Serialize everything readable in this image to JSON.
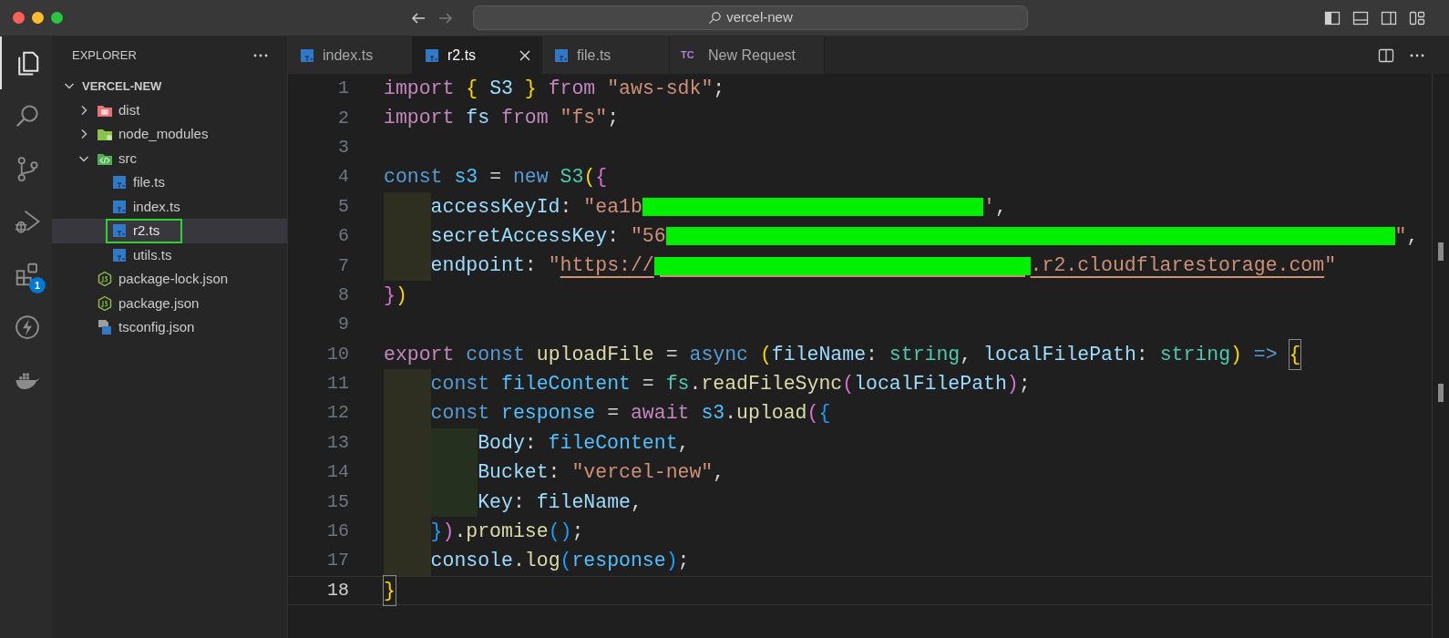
{
  "title_bar": {
    "search_field": {
      "value": "vercel-new"
    }
  },
  "activity_bar": [
    {
      "kind": "files",
      "selected": true
    },
    {
      "kind": "search",
      "selected": false
    },
    {
      "kind": "source-control",
      "selected": false
    },
    {
      "kind": "run-debug",
      "selected": false
    },
    {
      "kind": "extensions",
      "selected": false,
      "badge": "1"
    },
    {
      "kind": "lightning",
      "selected": false
    },
    {
      "kind": "docker",
      "selected": false
    }
  ],
  "explorer": {
    "title": "EXPLORER",
    "tree": [
      {
        "label": "VERCEL-NEW",
        "kind": "root",
        "expanded": true,
        "selected": false,
        "outlined": false,
        "children": [
          {
            "label": "dist",
            "kind": "folder-red",
            "expanded": false,
            "selected": false,
            "outlined": false
          },
          {
            "label": "node_modules",
            "kind": "folder-green",
            "expanded": false,
            "selected": false,
            "outlined": false
          },
          {
            "label": "src",
            "kind": "folder-code",
            "expanded": true,
            "selected": false,
            "outlined": false,
            "children": [
              {
                "label": "file.ts",
                "kind": "ts",
                "selected": false,
                "outlined": false
              },
              {
                "label": "index.ts",
                "kind": "ts",
                "selected": false,
                "outlined": false
              },
              {
                "label": "r2.ts",
                "kind": "ts",
                "selected": true,
                "outlined": true
              },
              {
                "label": "utils.ts",
                "kind": "ts",
                "selected": false,
                "outlined": false
              }
            ]
          },
          {
            "label": "package-lock.json",
            "kind": "json",
            "selected": false,
            "outlined": false
          },
          {
            "label": "package.json",
            "kind": "json",
            "selected": false,
            "outlined": false
          },
          {
            "label": "tsconfig.json",
            "kind": "tsconfig",
            "selected": false,
            "outlined": false
          }
        ]
      }
    ]
  },
  "tabs": [
    {
      "label": "index.ts",
      "kind": "ts",
      "selected": false
    },
    {
      "label": "r2.ts",
      "kind": "ts",
      "selected": true
    },
    {
      "label": "file.ts",
      "kind": "ts",
      "selected": false
    },
    {
      "label": "New Request",
      "kind": "badge",
      "badge": "TC",
      "selected": false
    }
  ],
  "editor": {
    "lines": [
      {
        "number": "1",
        "current": false,
        "tokens": [
          {
            "text": "import ",
            "kind": "keyword"
          },
          {
            "text": "{",
            "kind": "bracket1"
          },
          {
            "text": " S3 ",
            "kind": "variable"
          },
          {
            "text": "}",
            "kind": "bracket1"
          },
          {
            "text": " from ",
            "kind": "keyword"
          },
          {
            "text": "\"aws-sdk\"",
            "kind": "string"
          },
          {
            "text": ";",
            "kind": "punct"
          }
        ]
      },
      {
        "number": "2",
        "current": false,
        "tokens": [
          {
            "text": "import ",
            "kind": "keyword"
          },
          {
            "text": "fs",
            "kind": "variable"
          },
          {
            "text": " from ",
            "kind": "keyword"
          },
          {
            "text": "\"fs\"",
            "kind": "string"
          },
          {
            "text": ";",
            "kind": "punct"
          }
        ]
      },
      {
        "number": "3",
        "current": false
      },
      {
        "number": "4",
        "current": false,
        "tokens": [
          {
            "text": "const ",
            "kind": "storage"
          },
          {
            "text": "s3",
            "kind": "constant"
          },
          {
            "text": " = ",
            "kind": "punct"
          },
          {
            "text": "new ",
            "kind": "storage"
          },
          {
            "text": "S3",
            "kind": "type"
          },
          {
            "text": "(",
            "kind": "bracket1"
          },
          {
            "text": "{",
            "kind": "bracket2"
          }
        ]
      },
      {
        "number": "5",
        "current": false,
        "tokens": [
          {
            "kind": "indent"
          },
          {
            "text": "accessKeyId",
            "kind": "variable"
          },
          {
            "text": ": ",
            "kind": "punct"
          },
          {
            "text": "\"ea1b",
            "kind": "string"
          },
          {
            "kind": "redaction"
          },
          {
            "text": "'",
            "kind": "string"
          },
          {
            "text": ",",
            "kind": "punct"
          }
        ]
      },
      {
        "number": "6",
        "current": false,
        "tokens": [
          {
            "kind": "indent"
          },
          {
            "text": "secretAccessKey",
            "kind": "variable"
          },
          {
            "text": ": ",
            "kind": "punct"
          },
          {
            "text": "\"56",
            "kind": "string"
          },
          {
            "kind": "redaction"
          },
          {
            "text": "\"",
            "kind": "string"
          },
          {
            "text": ",",
            "kind": "punct"
          }
        ]
      },
      {
        "number": "7",
        "current": false,
        "tokens": [
          {
            "kind": "indent"
          },
          {
            "text": "endpoint",
            "kind": "variable"
          },
          {
            "text": ": ",
            "kind": "punct"
          },
          {
            "text": "\"",
            "kind": "string"
          },
          {
            "text": "https://",
            "kind": "link"
          },
          {
            "kind": "redaction-link"
          },
          {
            "text": ".r2.cloudflarestorage.com",
            "kind": "link"
          },
          {
            "text": "\"",
            "kind": "string"
          }
        ]
      },
      {
        "number": "8",
        "current": false,
        "tokens": [
          {
            "text": "}",
            "kind": "bracket2"
          },
          {
            "text": ")",
            "kind": "bracket1"
          }
        ]
      },
      {
        "number": "9",
        "current": false
      },
      {
        "number": "10",
        "current": false,
        "tokens": [
          {
            "text": "export ",
            "kind": "keyword"
          },
          {
            "text": "const ",
            "kind": "storage"
          },
          {
            "text": "uploadFile",
            "kind": "function"
          },
          {
            "text": " = ",
            "kind": "punct"
          },
          {
            "text": "async ",
            "kind": "storage"
          },
          {
            "text": "(",
            "kind": "bracket1"
          },
          {
            "text": "fileName",
            "kind": "variable"
          },
          {
            "text": ": ",
            "kind": "punct"
          },
          {
            "text": "string",
            "kind": "type"
          },
          {
            "text": ", ",
            "kind": "punct"
          },
          {
            "text": "localFilePath",
            "kind": "variable"
          },
          {
            "text": ": ",
            "kind": "punct"
          },
          {
            "text": "string",
            "kind": "type"
          },
          {
            "text": ")",
            "kind": "bracket1"
          },
          {
            "text": " => ",
            "kind": "storage"
          },
          {
            "text": "{",
            "kind": "bracket1-match"
          }
        ]
      },
      {
        "number": "11",
        "current": false,
        "tokens": [
          {
            "kind": "indent"
          },
          {
            "text": "const ",
            "kind": "storage"
          },
          {
            "text": "fileContent",
            "kind": "constant"
          },
          {
            "text": " = ",
            "kind": "punct"
          },
          {
            "text": "fs",
            "kind": "type"
          },
          {
            "text": ".",
            "kind": "punct"
          },
          {
            "text": "readFileSync",
            "kind": "function"
          },
          {
            "text": "(",
            "kind": "bracket2"
          },
          {
            "text": "localFilePath",
            "kind": "variable"
          },
          {
            "text": ")",
            "kind": "bracket2"
          },
          {
            "text": ";",
            "kind": "punct"
          }
        ]
      },
      {
        "number": "12",
        "current": false,
        "tokens": [
          {
            "kind": "indent"
          },
          {
            "text": "const ",
            "kind": "storage"
          },
          {
            "text": "response",
            "kind": "constant"
          },
          {
            "text": " = ",
            "kind": "punct"
          },
          {
            "text": "await ",
            "kind": "keyword"
          },
          {
            "text": "s3",
            "kind": "constant"
          },
          {
            "text": ".",
            "kind": "punct"
          },
          {
            "text": "upload",
            "kind": "function"
          },
          {
            "text": "(",
            "kind": "bracket2"
          },
          {
            "text": "{",
            "kind": "bracket3"
          }
        ]
      },
      {
        "number": "13",
        "current": false,
        "tokens": [
          {
            "kind": "indent"
          },
          {
            "kind": "indent"
          },
          {
            "text": "Body",
            "kind": "variable"
          },
          {
            "text": ": ",
            "kind": "punct"
          },
          {
            "text": "fileContent",
            "kind": "constant"
          },
          {
            "text": ",",
            "kind": "punct"
          }
        ]
      },
      {
        "number": "14",
        "current": false,
        "tokens": [
          {
            "kind": "indent"
          },
          {
            "kind": "indent"
          },
          {
            "text": "Bucket",
            "kind": "variable"
          },
          {
            "text": ": ",
            "kind": "punct"
          },
          {
            "text": "\"vercel-new\"",
            "kind": "string"
          },
          {
            "text": ",",
            "kind": "punct"
          }
        ]
      },
      {
        "number": "15",
        "current": false,
        "tokens": [
          {
            "kind": "indent"
          },
          {
            "kind": "indent"
          },
          {
            "text": "Key",
            "kind": "variable"
          },
          {
            "text": ": ",
            "kind": "punct"
          },
          {
            "text": "fileName",
            "kind": "variable"
          },
          {
            "text": ",",
            "kind": "punct"
          }
        ]
      },
      {
        "number": "16",
        "current": false,
        "tokens": [
          {
            "kind": "indent"
          },
          {
            "text": "}",
            "kind": "bracket3"
          },
          {
            "text": ")",
            "kind": "bracket2"
          },
          {
            "text": ".",
            "kind": "punct"
          },
          {
            "text": "promise",
            "kind": "function"
          },
          {
            "text": "()",
            "kind": "bracket3"
          },
          {
            "text": ";",
            "kind": "punct"
          }
        ]
      },
      {
        "number": "17",
        "current": false,
        "tokens": [
          {
            "kind": "indent"
          },
          {
            "text": "console",
            "kind": "variable"
          },
          {
            "text": ".",
            "kind": "punct"
          },
          {
            "text": "log",
            "kind": "function"
          },
          {
            "text": "(",
            "kind": "bracket3"
          },
          {
            "text": "response",
            "kind": "constant"
          },
          {
            "text": ")",
            "kind": "bracket3"
          },
          {
            "text": ";",
            "kind": "punct"
          }
        ]
      },
      {
        "number": "18",
        "current": true,
        "tokens": [
          {
            "text": "}",
            "kind": "bracket1-match"
          }
        ]
      }
    ]
  }
}
